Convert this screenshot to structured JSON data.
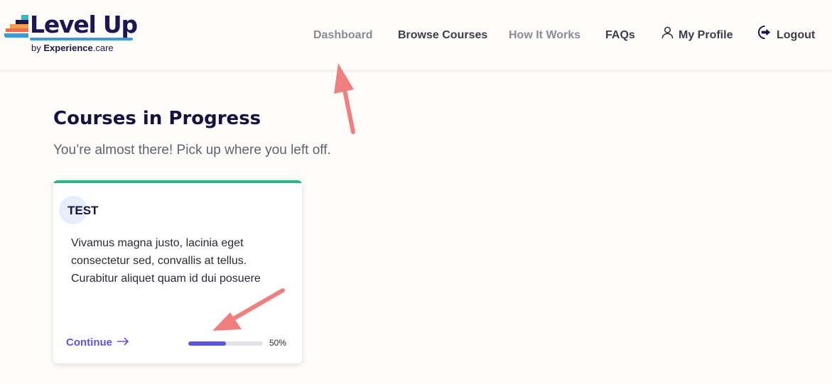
{
  "brand": {
    "name": "Level Up",
    "byline_prefix": "by",
    "byline_company": "Experience",
    "byline_suffix": ".care"
  },
  "nav": {
    "items": [
      {
        "label": "Dashboard",
        "icon": null
      },
      {
        "label": "Browse Courses",
        "icon": null
      },
      {
        "label": "How It Works",
        "icon": null
      },
      {
        "label": "FAQs",
        "icon": null
      },
      {
        "label": "My Profile",
        "icon": "user-icon"
      },
      {
        "label": "Logout",
        "icon": "logout-icon"
      }
    ]
  },
  "page": {
    "title": "Courses in Progress",
    "subtitle": "You’re almost there! Pick up where you left off."
  },
  "courses": [
    {
      "title": "TEST",
      "description": "Vivamus magna justo, lacinia eget consectetur sed, convallis at tellus. Curabitur aliquet quam id dui posuere",
      "continue_label": "Continue",
      "progress_percent": 50,
      "progress_label": "50%"
    }
  ],
  "colors": {
    "accent": "#5a55e0",
    "card_top_bar": "#23b98a",
    "heading": "#15123f",
    "annotation_arrow": "#f08080"
  }
}
